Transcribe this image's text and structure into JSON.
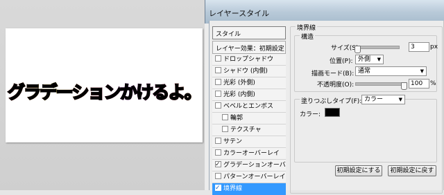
{
  "canvas": {
    "sample_text": "グラデーションかけるよ。"
  },
  "dialog": {
    "title": "レイヤースタイル",
    "style_list": {
      "header": "スタイル",
      "blending_header": "レイヤー効果：初期設定",
      "items": [
        {
          "label": "ドロップシャドウ",
          "checked": false
        },
        {
          "label": "シャドウ (内側)",
          "checked": false
        },
        {
          "label": "光彩 (外側)",
          "checked": false
        },
        {
          "label": "光彩 (内側)",
          "checked": false
        },
        {
          "label": "ベベルとエンボス",
          "checked": false
        },
        {
          "label": "輪郭",
          "checked": false
        },
        {
          "label": "テクスチャ",
          "checked": false
        },
        {
          "label": "サテン",
          "checked": false
        },
        {
          "label": "カラーオーバーレイ",
          "checked": false
        },
        {
          "label": "グラデーションオーバーレイ",
          "checked": true
        },
        {
          "label": "パターンオーバーレイ",
          "checked": false
        },
        {
          "label": "境界線",
          "checked": true
        }
      ]
    },
    "stroke": {
      "group_title": "境界線",
      "structure_title": "構造",
      "size_label": "サイズ(S):",
      "size_value": "3",
      "size_unit": "px",
      "size_level": 0.02,
      "position_label": "位置(P):",
      "position_value": "外側",
      "blend_label": "描画モード(B):",
      "blend_value": "通常",
      "opacity_label": "不透明度(O):",
      "opacity_value": "100",
      "opacity_unit": "%",
      "opacity_level": 1.0,
      "fill_type_label": "塗りつぶしタイプ(F):",
      "fill_type_value": "カラー",
      "color_label": "カラー:",
      "color_value": "#000000"
    },
    "buttons": {
      "make_default": "初期設定にする",
      "reset_default": "初期設定に戻す"
    }
  }
}
